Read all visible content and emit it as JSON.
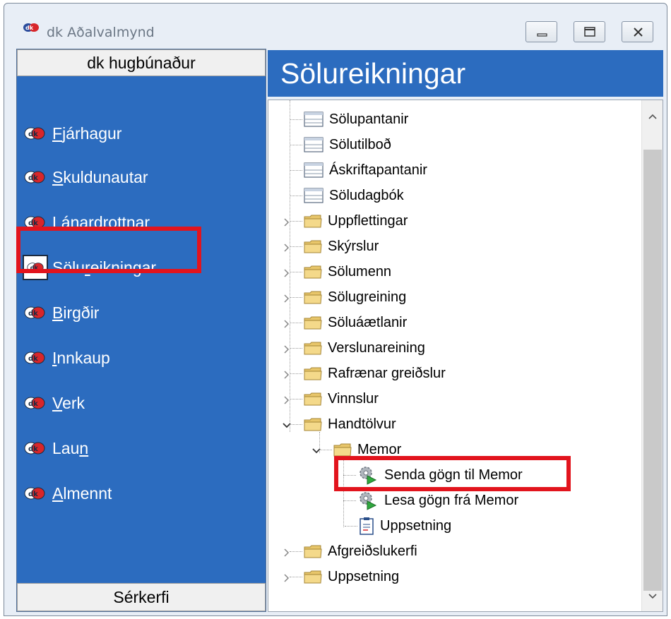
{
  "window": {
    "title": "dk Aðalvalmynd"
  },
  "left_panel": {
    "header": "dk hugbúnaður",
    "footer": "Sérkerfi",
    "items": [
      {
        "pre": "",
        "ul": "F",
        "post": "járhagur"
      },
      {
        "pre": "",
        "ul": "S",
        "post": "kuldunautar"
      },
      {
        "pre": "",
        "ul": "L",
        "post": "ánardrottnar"
      },
      {
        "pre": "Sölu",
        "ul": "r",
        "post": "eikningar"
      },
      {
        "pre": "",
        "ul": "B",
        "post": "irgðir"
      },
      {
        "pre": "",
        "ul": "I",
        "post": "nnkaup"
      },
      {
        "pre": "",
        "ul": "V",
        "post": "erk"
      },
      {
        "pre": "Lau",
        "ul": "n",
        "post": ""
      },
      {
        "pre": "",
        "ul": "A",
        "post": "lmennt"
      }
    ]
  },
  "right_panel": {
    "header": "Sölureikningar",
    "tree": [
      "Sölupantanir",
      "Sölutilboð",
      "Áskriftapantanir",
      "Söludagbók",
      "Uppflettingar",
      "Skýrslur",
      "Sölumenn",
      "Sölugreining",
      "Söluáætlanir",
      "Verslunareining",
      "Rafrænar greiðslur",
      "Vinnslur",
      "Handtölvur",
      "Memor",
      "Senda gögn til Memor",
      "Lesa gögn frá Memor",
      "Uppsetning",
      "Afgreiðslukerfi",
      "Uppsetning"
    ]
  },
  "colors": {
    "panel_blue": "#2c6cbf",
    "highlight_red": "#e2141d"
  },
  "icons": {
    "app": "dk-logo-icon",
    "nav": "dk-eye-icon",
    "form": "form-icon",
    "folder": "folder-icon",
    "gear": "gear-arrow-icon",
    "doc": "document-icon"
  }
}
